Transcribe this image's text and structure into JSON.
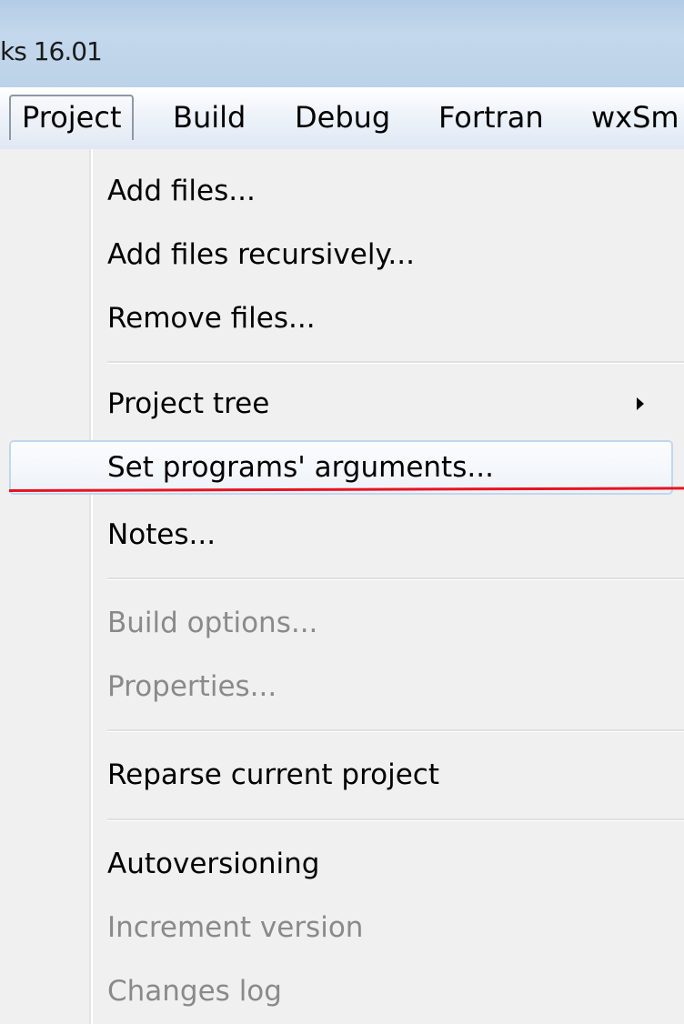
{
  "window": {
    "title_fragment": "ks 16.01"
  },
  "menubar": {
    "items": [
      {
        "label": "Project",
        "open": true
      },
      {
        "label": "Build",
        "open": false
      },
      {
        "label": "Debug",
        "open": false
      },
      {
        "label": "Fortran",
        "open": false
      },
      {
        "label": "wxSm",
        "open": false
      }
    ]
  },
  "dropdown": {
    "items": [
      {
        "label": "Add files...",
        "enabled": true
      },
      {
        "label": "Add files recursively...",
        "enabled": true
      },
      {
        "label": "Remove files...",
        "enabled": true
      },
      {
        "label": "Project tree",
        "enabled": true,
        "submenu": true
      },
      {
        "label": "Set programs' arguments...",
        "enabled": true,
        "highlighted": true
      },
      {
        "label": "Notes...",
        "enabled": true
      },
      {
        "label": "Build options...",
        "enabled": false
      },
      {
        "label": "Properties...",
        "enabled": false
      },
      {
        "label": "Reparse current project",
        "enabled": true
      },
      {
        "label": "Autoversioning",
        "enabled": true
      },
      {
        "label": "Increment version",
        "enabled": false
      },
      {
        "label": "Changes log",
        "enabled": false
      }
    ]
  },
  "annotation": {
    "color": "#e8131f",
    "target": "Set programs' arguments..."
  },
  "colors": {
    "titlebar": "#bcd2e8",
    "menu_background": "#f0f0f0",
    "disabled_text": "#8a8a8a",
    "highlight_border": "#c1d7ee"
  }
}
